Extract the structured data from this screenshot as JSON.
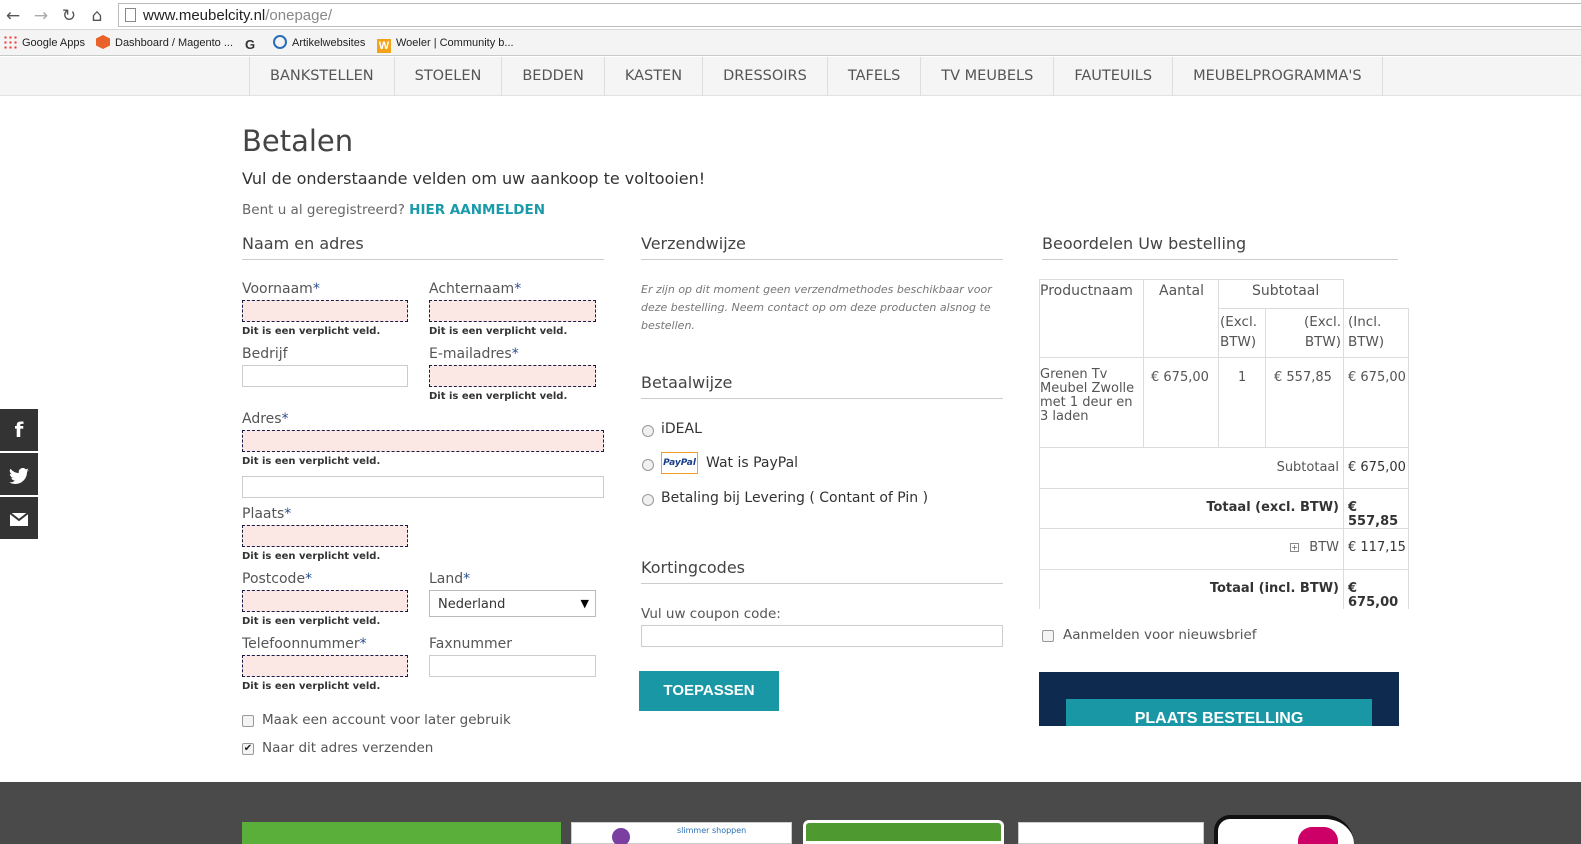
{
  "browser": {
    "url_domain": "www.meubelcity.nl",
    "url_path": "/onepage/",
    "bookmarks": [
      "Google Apps",
      "Dashboard / Magento ...",
      "G",
      "Artikelwebsites",
      "Woeler | Community b..."
    ]
  },
  "nav": {
    "items": [
      "BANKSTELLEN",
      "STOELEN",
      "BEDDEN",
      "KASTEN",
      "DRESSOIRS",
      "TAFELS",
      "TV MEUBELS",
      "FAUTEUILS",
      "MEUBELPROGRAMMA'S"
    ]
  },
  "social": {
    "icons": [
      "facebook-icon",
      "twitter-icon",
      "mail-icon"
    ]
  },
  "page": {
    "title": "Betalen",
    "subtitle": "Vul de onderstaande velden om uw aankoop te voltooien!",
    "login_prompt": "Bent u al geregistreerd?",
    "login_link": "HIER AANMELDEN"
  },
  "address": {
    "section_title": "Naam en adres",
    "required_mark": "*",
    "error_text": "Dit is een verplicht veld.",
    "firstname_label": "Voornaam",
    "lastname_label": "Achternaam",
    "company_label": "Bedrijf",
    "email_label": "E-mailadres",
    "street_label": "Adres",
    "city_label": "Plaats",
    "postcode_label": "Postcode",
    "country_label": "Land",
    "country_value": "Nederland",
    "phone_label": "Telefoonnummer",
    "fax_label": "Faxnummer",
    "create_account_label": "Maak een account voor later gebruik",
    "ship_same_label": "Naar dit adres verzenden",
    "ship_same_checked": true
  },
  "shipping": {
    "section_title": "Verzendwijze",
    "note": "Er zijn op dit moment geen verzendmethodes beschikbaar voor deze bestelling. Neem contact op om deze producten alsnog te bestellen."
  },
  "payment": {
    "section_title": "Betaalwijze",
    "options": [
      "iDEAL",
      "Wat is PayPal",
      "Betaling bij Levering ( Contant of Pin )"
    ],
    "paypal_logo": "PayPal"
  },
  "coupon": {
    "section_title": "Kortingcodes",
    "label": "Vul uw coupon code:",
    "button": "TOEPASSEN"
  },
  "review": {
    "section_title": "Beoordelen Uw bestelling",
    "headers": {
      "product": "Productnaam",
      "qty": "Aantal",
      "subtotal": "Subtotaal",
      "excl": "(Excl. BTW)",
      "incl": "(Incl. BTW)"
    },
    "item": {
      "name": "Grenen Tv Meubel Zwolle met 1 deur en 3 laden",
      "price": "€ 675,00",
      "qty": "1",
      "subtotal_excl": "€ 557,85",
      "subtotal_incl": "€ 675,00"
    },
    "totals": [
      {
        "label": "Subtotaal",
        "value": "€ 675,00"
      },
      {
        "label": "Totaal (excl. BTW)",
        "value": "€ 557,85"
      },
      {
        "label": "BTW",
        "value": "€ 117,15"
      },
      {
        "label": "Totaal (incl. BTW)",
        "value": "€ 675,00"
      }
    ],
    "newsletter_label": "Aanmelden voor nieuwsbrief",
    "order_button": "PLAATS BESTELLING"
  },
  "footer": {
    "badge_text": "slimmer shoppen"
  },
  "colors": {
    "accent": "#1a97a5",
    "order_bg": "#0e2a4e",
    "error_bg": "#fbe7e3"
  }
}
